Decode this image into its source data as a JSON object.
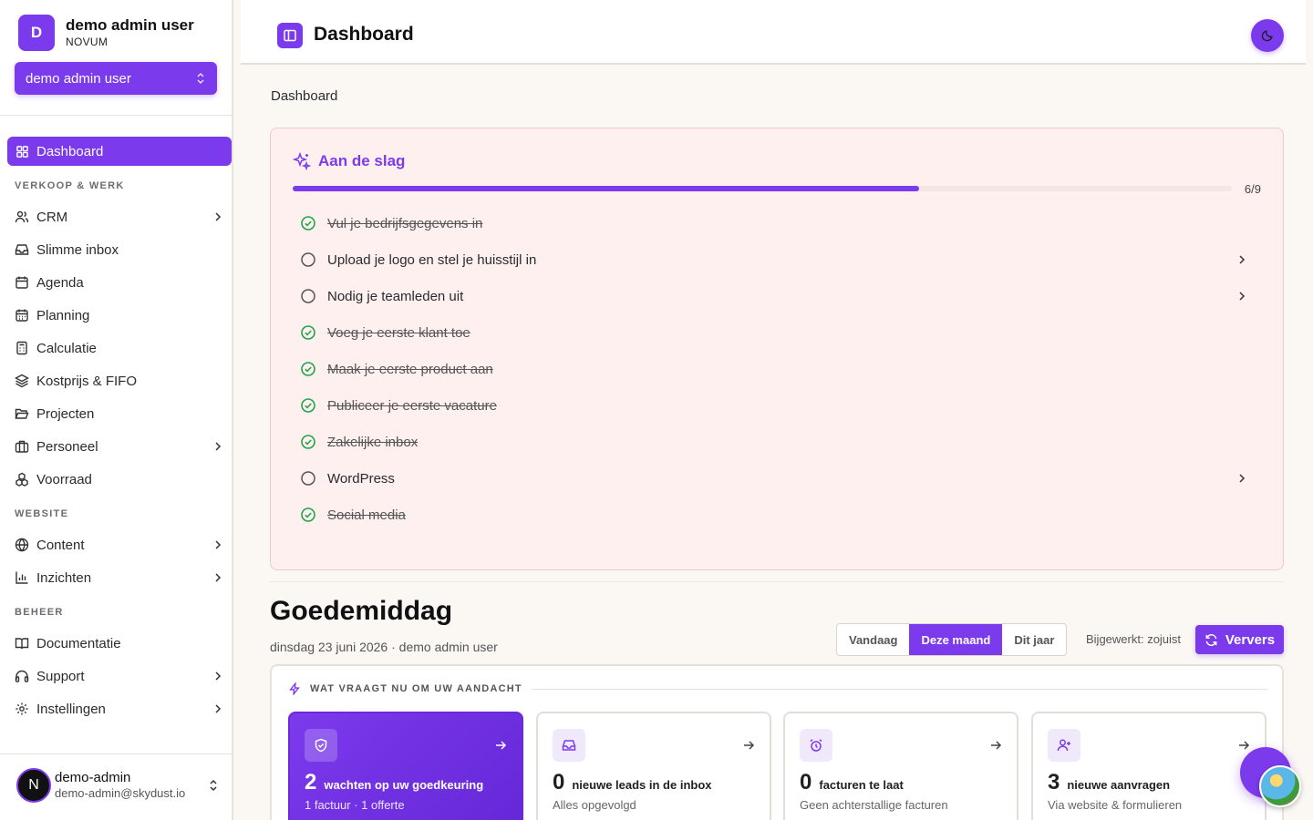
{
  "org": {
    "avatar_letter": "D",
    "name": "demo admin user",
    "subtitle": "NOVUM"
  },
  "user_switcher": {
    "value": "demo admin user"
  },
  "sidebar": {
    "dashboard": "Dashboard",
    "section_sales": "VERKOOP & WERK",
    "sales_items": [
      "CRM",
      "Slimme inbox",
      "Agenda",
      "Planning",
      "Calculatie",
      "Kostprijs & FIFO",
      "Projecten",
      "Personeel",
      "Voorraad"
    ],
    "section_website": "WEBSITE",
    "website_items": [
      "Content",
      "Inzichten"
    ],
    "section_manage": "BEHEER",
    "manage_items": [
      "Documentatie",
      "Support",
      "Instellingen"
    ]
  },
  "footer_user": {
    "avatar_letter": "N",
    "name": "demo-admin",
    "email": "demo-admin@skydust.io"
  },
  "header": {
    "title": "Dashboard"
  },
  "breadcrumb": "Dashboard",
  "onboarding": {
    "title": "Aan de slag",
    "progress_count": "6/9",
    "progress_fraction": 0.667,
    "tasks": [
      {
        "label": "Vul je bedrijfsgegevens in",
        "done": true
      },
      {
        "label": "Upload je logo en stel je huisstijl in",
        "done": false
      },
      {
        "label": "Nodig je teamleden uit",
        "done": false
      },
      {
        "label": "Voeg je eerste klant toe",
        "done": true
      },
      {
        "label": "Maak je eerste product aan",
        "done": true
      },
      {
        "label": "Publiceer je eerste vacature",
        "done": true
      },
      {
        "label": "Zakelijke inbox",
        "done": true
      },
      {
        "label": "WordPress",
        "done": false
      },
      {
        "label": "Social media",
        "done": true
      }
    ]
  },
  "greeting": {
    "title": "Goedemiddag",
    "subtitle": "dinsdag 23 juni 2026 · demo admin user",
    "ranges": [
      "Vandaag",
      "Deze maand",
      "Dit jaar"
    ],
    "active_range": "Deze maand",
    "updated": "Bijgewerkt: zojuist",
    "refresh": "Ververs"
  },
  "attention": {
    "heading": "WAT VRAAGT NU OM UW AANDACHT",
    "cards": [
      {
        "icon": "shield-check-icon",
        "number": "2",
        "label": "wachten op uw goedkeuring",
        "sub": "1 factuur · 1 offerte"
      },
      {
        "icon": "inbox-icon",
        "number": "0",
        "label": "nieuwe leads in de inbox",
        "sub": "Alles opgevolgd"
      },
      {
        "icon": "alarm-clock-icon",
        "number": "0",
        "label": "facturen te laat",
        "sub": "Geen achterstallige facturen"
      },
      {
        "icon": "user-plus-icon",
        "number": "3",
        "label": "nieuwe aanvragen",
        "sub": "Via website & formulieren"
      }
    ]
  },
  "colors": {
    "accent": "#7c3aed",
    "done_check": "#22a34a",
    "onboarding_bg": "#fdf0ef"
  }
}
